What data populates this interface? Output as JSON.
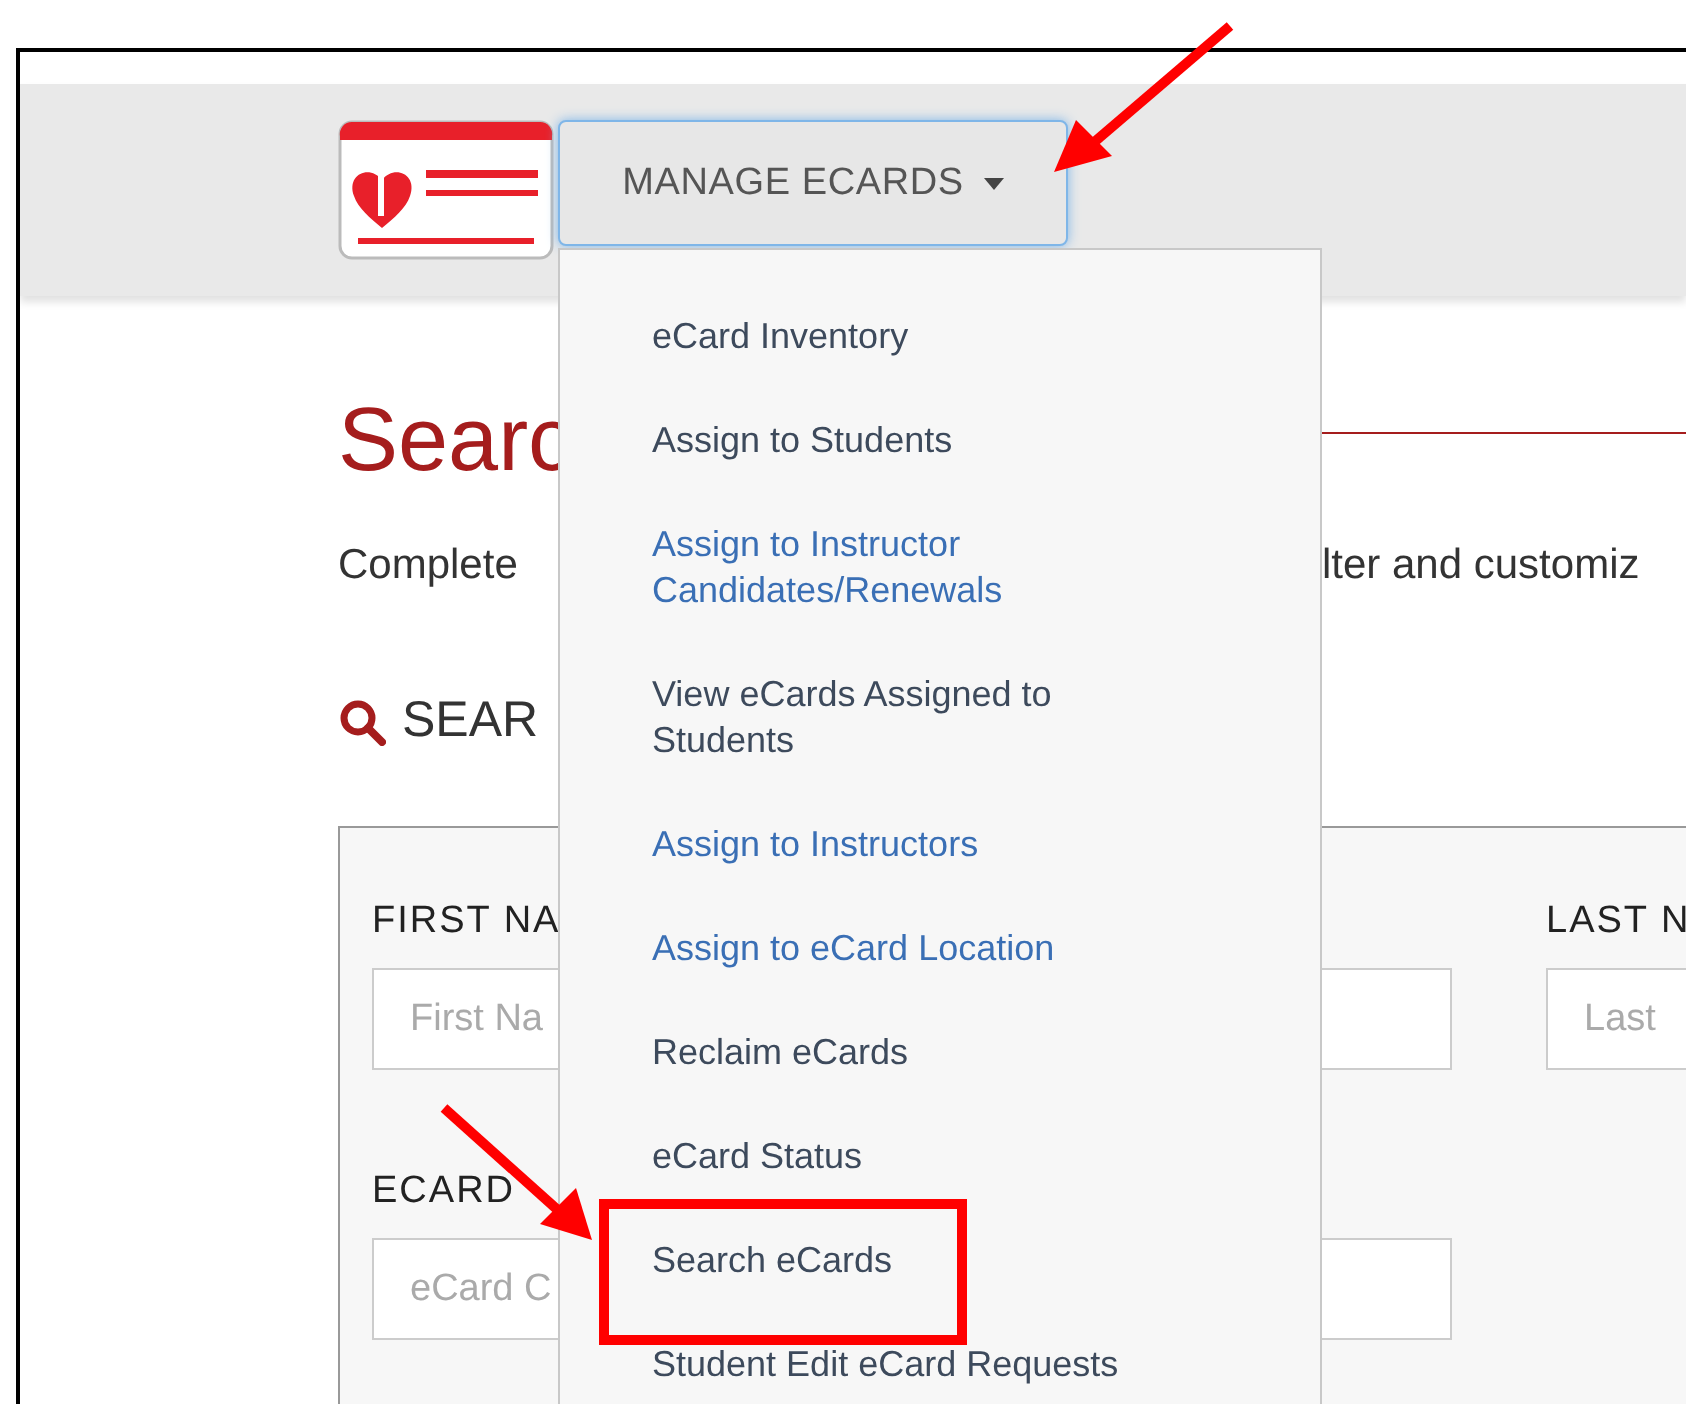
{
  "nav": {
    "menu_button": {
      "label": "MANAGE ECARDS",
      "expanded": true
    },
    "menu_items": [
      {
        "label": "eCard Inventory",
        "color": "#3d4a5c"
      },
      {
        "label": "Assign to Students",
        "color": "#3d4a5c"
      },
      {
        "label": "Assign to Instructor Candidates/Renewals",
        "color": "#3a6fb5"
      },
      {
        "label": "View eCards Assigned to Students",
        "color": "#3d4a5c"
      },
      {
        "label": "Assign to Instructors",
        "color": "#3a6fb5"
      },
      {
        "label": "Assign to eCard Location",
        "color": "#3a6fb5"
      },
      {
        "label": "Reclaim eCards",
        "color": "#3d4a5c"
      },
      {
        "label": "eCard Status",
        "color": "#3d4a5c"
      },
      {
        "label": "Search eCards",
        "color": "#3d4a5c"
      },
      {
        "label": "Student Edit eCard Requests",
        "color": "#3d4a5c"
      }
    ]
  },
  "page": {
    "title": "Searc",
    "intro_left": "Complete",
    "intro_right": "lter and customiz",
    "section_heading": "SEAR"
  },
  "form": {
    "fields": [
      {
        "label": "FIRST NA",
        "placeholder": "First Na"
      },
      {
        "label": "LAST N",
        "placeholder": "Last"
      },
      {
        "label": "ECARD",
        "placeholder": "eCard C"
      }
    ]
  }
}
